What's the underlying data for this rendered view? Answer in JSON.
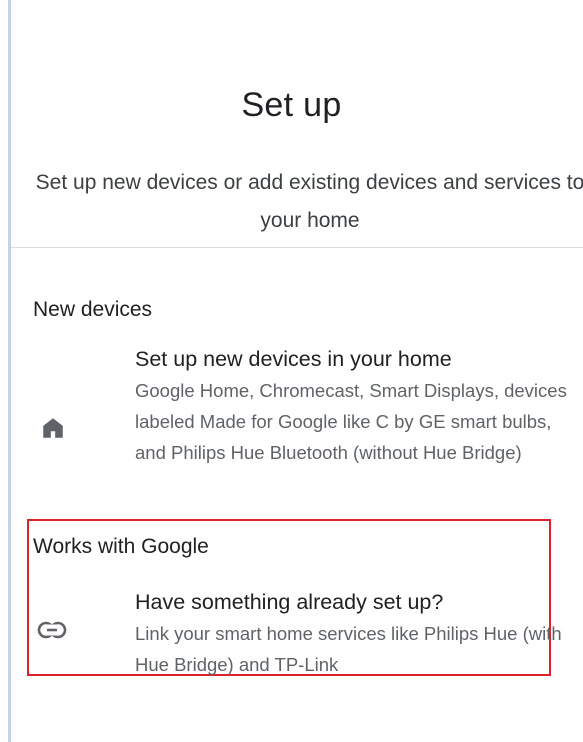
{
  "header": {
    "title": "Set up",
    "subtitle": "Set up new devices or add existing devices and services to your home"
  },
  "sections": {
    "new_devices": {
      "header": "New devices",
      "item": {
        "icon": "home-icon",
        "title": "Set up new devices in your home",
        "description": "Google Home, Chromecast, Smart Displays, devices labeled Made for Google like C by GE smart bulbs, and Philips Hue Bluetooth (without Hue Bridge)"
      }
    },
    "works_with_google": {
      "header": "Works with Google",
      "item": {
        "icon": "link-icon",
        "title": "Have something already set up?",
        "description": "Link your smart home services like Philips Hue (with Hue Bridge) and TP-Link"
      }
    }
  },
  "colors": {
    "highlight": "#e0212b",
    "text_primary": "#202124",
    "text_secondary": "#5f6368",
    "divider": "#dadce0"
  }
}
